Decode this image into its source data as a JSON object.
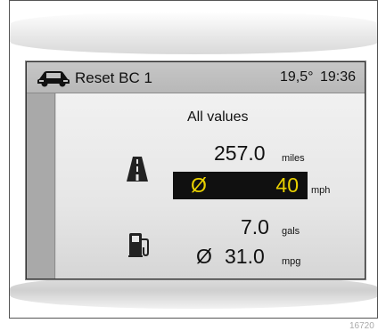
{
  "status": {
    "title": "Reset BC 1",
    "temperature": "19,5°",
    "time": "19:36"
  },
  "panel": {
    "heading": "All values",
    "distance": {
      "value": "257.0",
      "unit": "miles"
    },
    "speed": {
      "symbol": "Ø",
      "value": "40",
      "unit": "mph"
    },
    "fuel": {
      "value": "7.0",
      "unit": "gals"
    },
    "economy": {
      "symbol": "Ø",
      "value": "31.0",
      "unit": "mpg"
    }
  },
  "icons": {
    "status": "car-icon",
    "distance": "road-icon",
    "fuel": "fuel-pump-icon"
  },
  "colors": {
    "highlight_text": "#e8d000",
    "highlight_bg": "#101010"
  },
  "figure_ref": "16720"
}
